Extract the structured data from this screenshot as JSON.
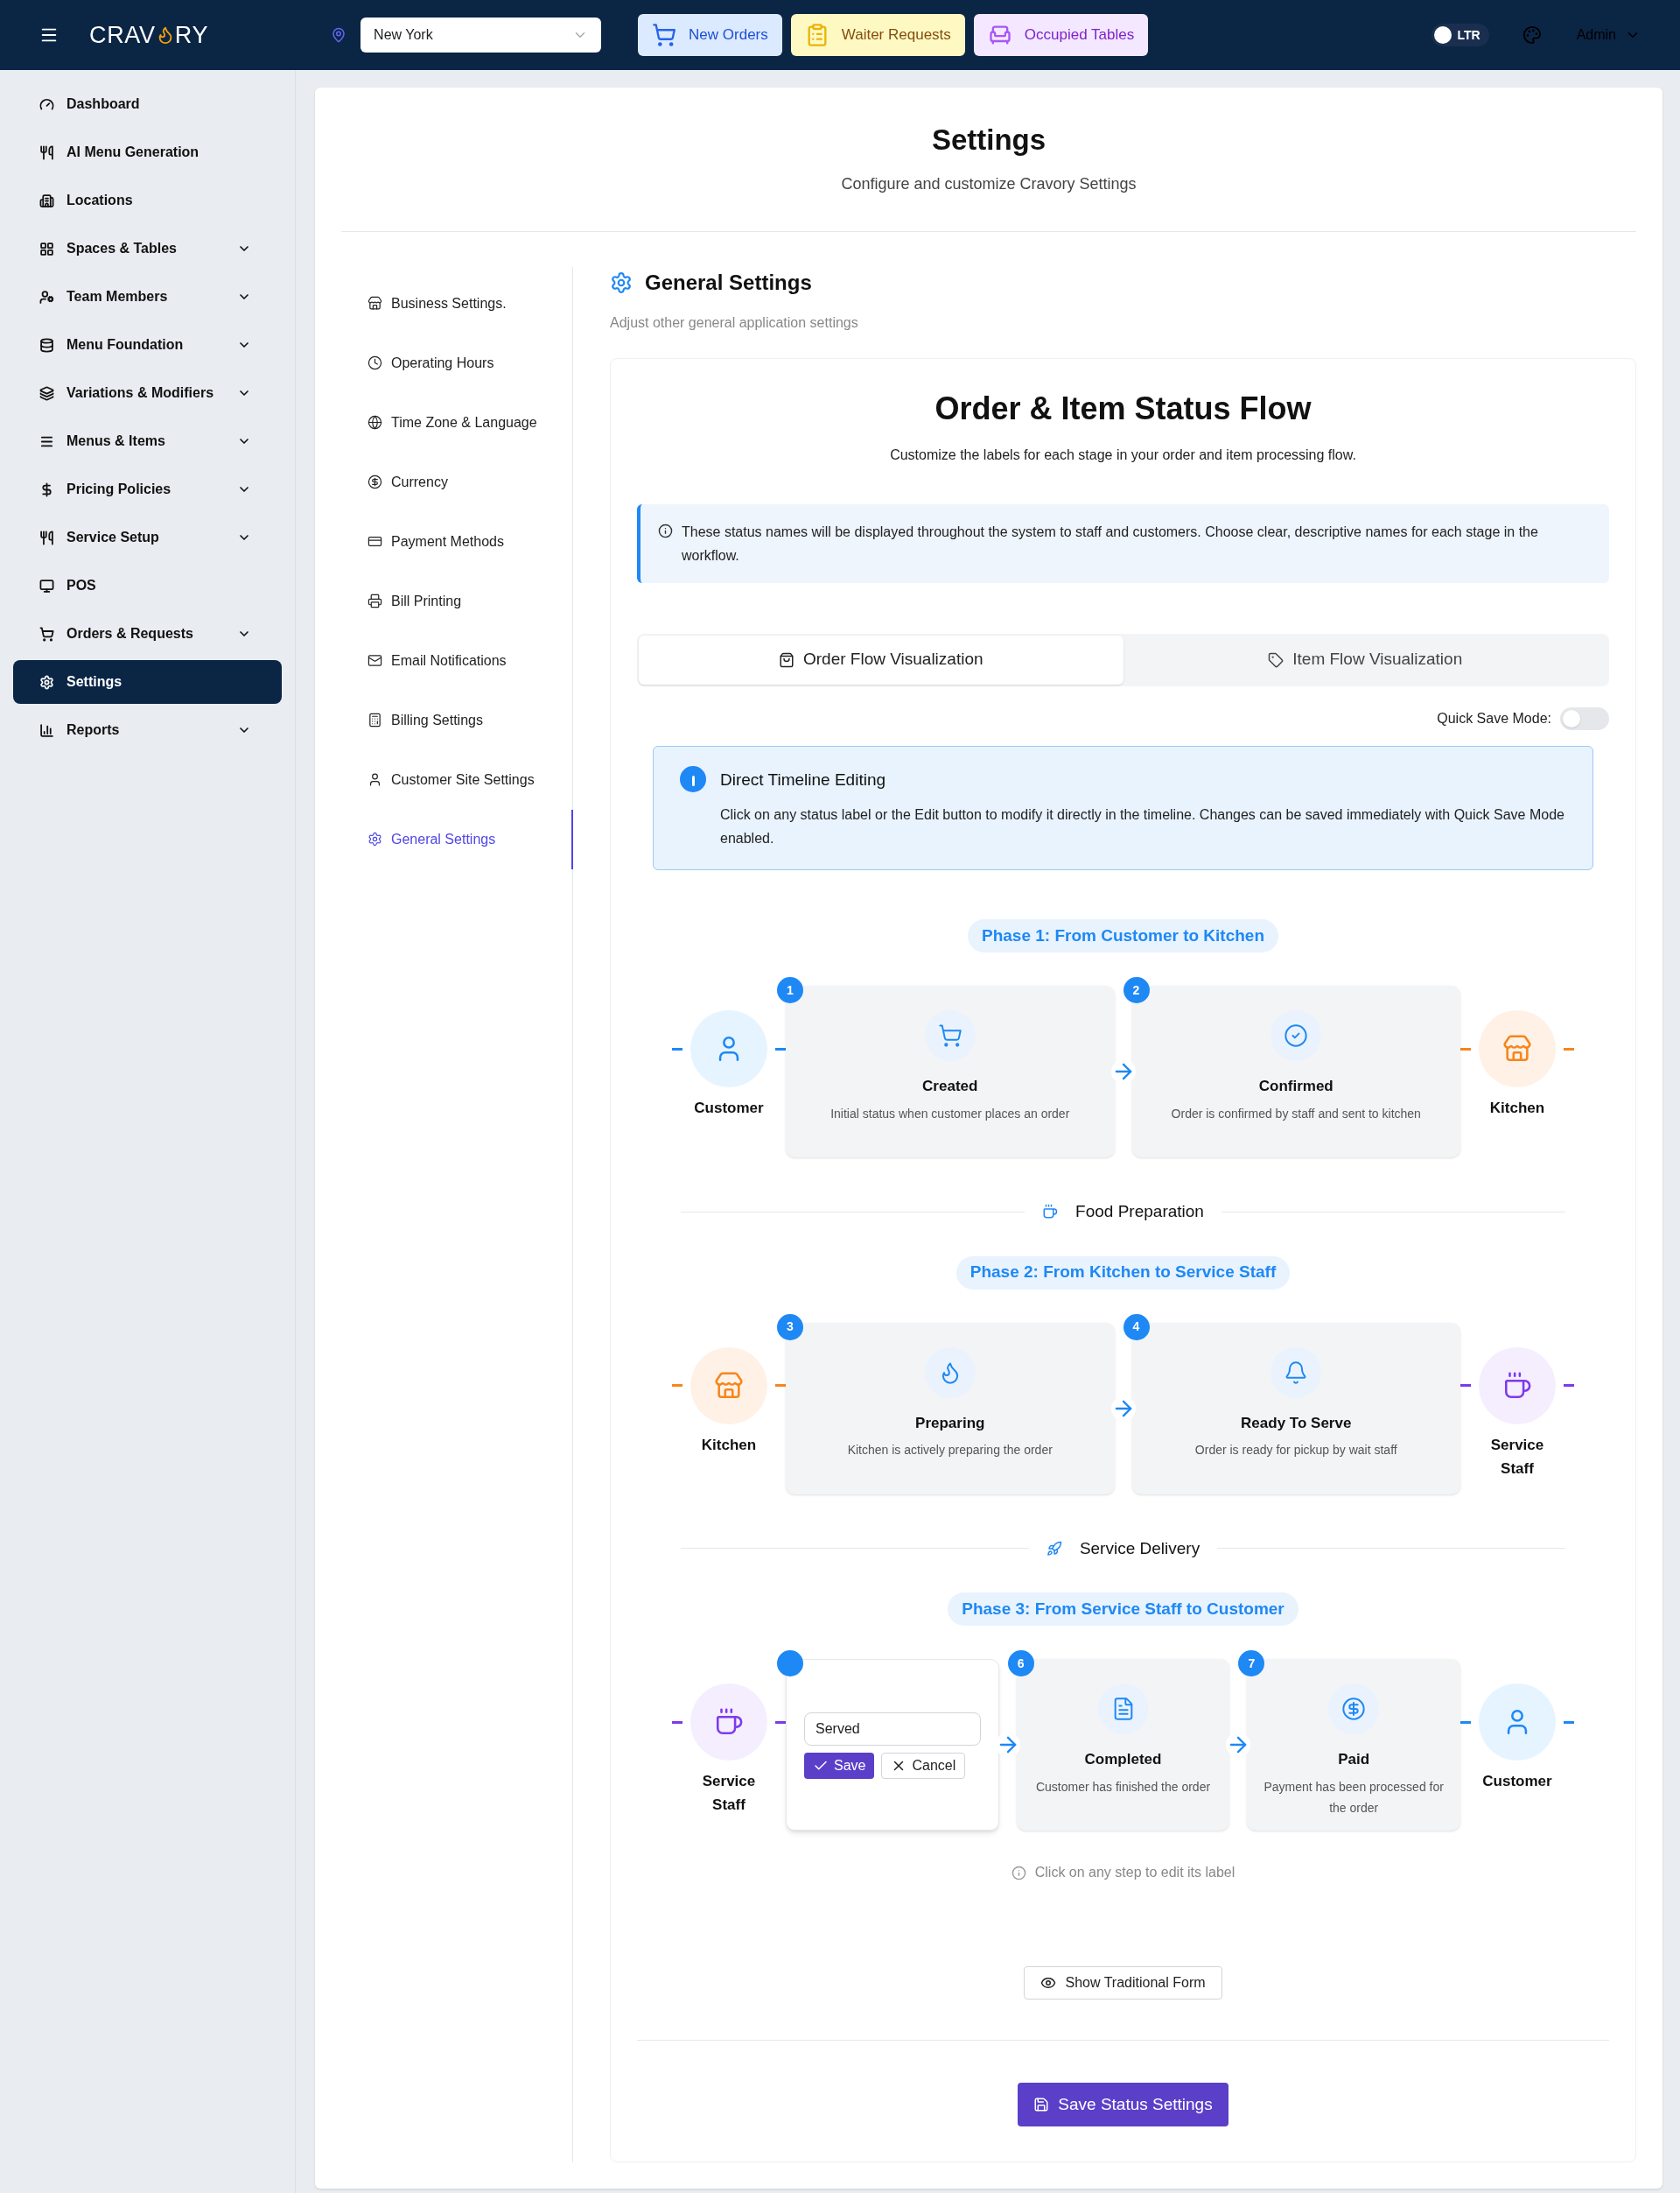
{
  "topbar": {
    "logo_left": "CRAV",
    "logo_right": "RY",
    "location": "New York",
    "quick_buttons": [
      {
        "kind": "orders",
        "label": "New Orders"
      },
      {
        "kind": "waiter",
        "label": "Waiter Requests"
      },
      {
        "kind": "tables",
        "label": "Occupied Tables"
      }
    ],
    "direction": {
      "label": "LTR",
      "on": false
    },
    "user": "Admin"
  },
  "sidebar": {
    "items": [
      {
        "label": "Dashboard",
        "expandable": false,
        "selected": false
      },
      {
        "label": "AI Menu Generation",
        "expandable": false,
        "selected": false
      },
      {
        "label": "Locations",
        "expandable": false,
        "selected": false
      },
      {
        "label": "Spaces & Tables",
        "expandable": true,
        "selected": false
      },
      {
        "label": "Team Members",
        "expandable": true,
        "selected": false
      },
      {
        "label": "Menu Foundation",
        "expandable": true,
        "selected": false
      },
      {
        "label": "Variations & Modifiers",
        "expandable": true,
        "selected": false
      },
      {
        "label": "Menus & Items",
        "expandable": true,
        "selected": false
      },
      {
        "label": "Pricing Policies",
        "expandable": true,
        "selected": false
      },
      {
        "label": "Service Setup",
        "expandable": true,
        "selected": false
      },
      {
        "label": "POS",
        "expandable": false,
        "selected": false
      },
      {
        "label": "Orders & Requests",
        "expandable": true,
        "selected": false
      },
      {
        "label": "Settings",
        "expandable": false,
        "selected": true
      },
      {
        "label": "Reports",
        "expandable": true,
        "selected": false
      }
    ]
  },
  "page": {
    "title": "Settings",
    "subtitle": "Configure and customize Cravory Settings"
  },
  "settings_nav": [
    {
      "label": "Business Settings.",
      "selected": false
    },
    {
      "label": "Operating Hours",
      "selected": false
    },
    {
      "label": "Time Zone & Language",
      "selected": false
    },
    {
      "label": "Currency",
      "selected": false
    },
    {
      "label": "Payment Methods",
      "selected": false
    },
    {
      "label": "Bill Printing",
      "selected": false
    },
    {
      "label": "Email Notifications",
      "selected": false
    },
    {
      "label": "Billing Settings",
      "selected": false
    },
    {
      "label": "Customer Site Settings",
      "selected": false
    },
    {
      "label": "General Settings",
      "selected": true
    }
  ],
  "section": {
    "title": "General Settings",
    "subtitle": "Adjust other general application settings"
  },
  "flow": {
    "title": "Order & Item Status Flow",
    "subtitle": "Customize the labels for each stage in your order and item processing flow.",
    "notice": "These status names will be displayed throughout the system to staff and customers. Choose clear, descriptive names for each stage in the workflow.",
    "tabs": [
      {
        "label": "Order Flow Visualization",
        "selected": true
      },
      {
        "label": "Item Flow Visualization",
        "selected": false
      }
    ],
    "quick_save": {
      "label": "Quick Save Mode:",
      "on": false
    },
    "tip": {
      "title": "Direct Timeline Editing",
      "text": "Click on any status label or the Edit button to modify it directly in the timeline. Changes can be saved immediately with Quick Save Mode enabled."
    },
    "phases": [
      {
        "title": "Phase 1: From Customer to Kitchen",
        "start": {
          "kind": "customer",
          "label": "Customer"
        },
        "end": {
          "kind": "kitchen",
          "label": "Kitchen"
        },
        "steps": [
          {
            "kind": "step",
            "number": "1",
            "label": "Created",
            "description": "Initial status when customer places an order"
          },
          {
            "kind": "step",
            "number": "2",
            "label": "Confirmed",
            "description": "Order is confirmed by staff and sent to kitchen"
          }
        ],
        "separator": {
          "label": "Food Preparation"
        }
      },
      {
        "title": "Phase 2: From Kitchen to Service Staff",
        "start": {
          "kind": "kitchen",
          "label": "Kitchen"
        },
        "end": {
          "kind": "staff",
          "label": "Service Staff"
        },
        "steps": [
          {
            "kind": "step",
            "number": "3",
            "label": "Preparing",
            "description": "Kitchen is actively preparing the order"
          },
          {
            "kind": "step",
            "number": "4",
            "label": "Ready To Serve",
            "description": "Order is ready for pickup by wait staff"
          }
        ],
        "separator": {
          "label": "Service Delivery"
        }
      },
      {
        "title": "Phase 3: From Service Staff to Customer",
        "start": {
          "kind": "staff",
          "label": "Service Staff"
        },
        "end": {
          "kind": "customer",
          "label": "Customer"
        },
        "steps": [
          {
            "kind": "editor",
            "value": "Served",
            "save": "Save",
            "cancel": "Cancel"
          },
          {
            "kind": "step",
            "number": "6",
            "label": "Completed",
            "description": "Customer has finished the order"
          },
          {
            "kind": "step",
            "number": "7",
            "label": "Paid",
            "description": "Payment has been processed for the order"
          }
        ]
      }
    ],
    "hint": "Click on any step to edit its label",
    "traditional_button": "Show Traditional Form",
    "save_button": "Save Status Settings"
  }
}
